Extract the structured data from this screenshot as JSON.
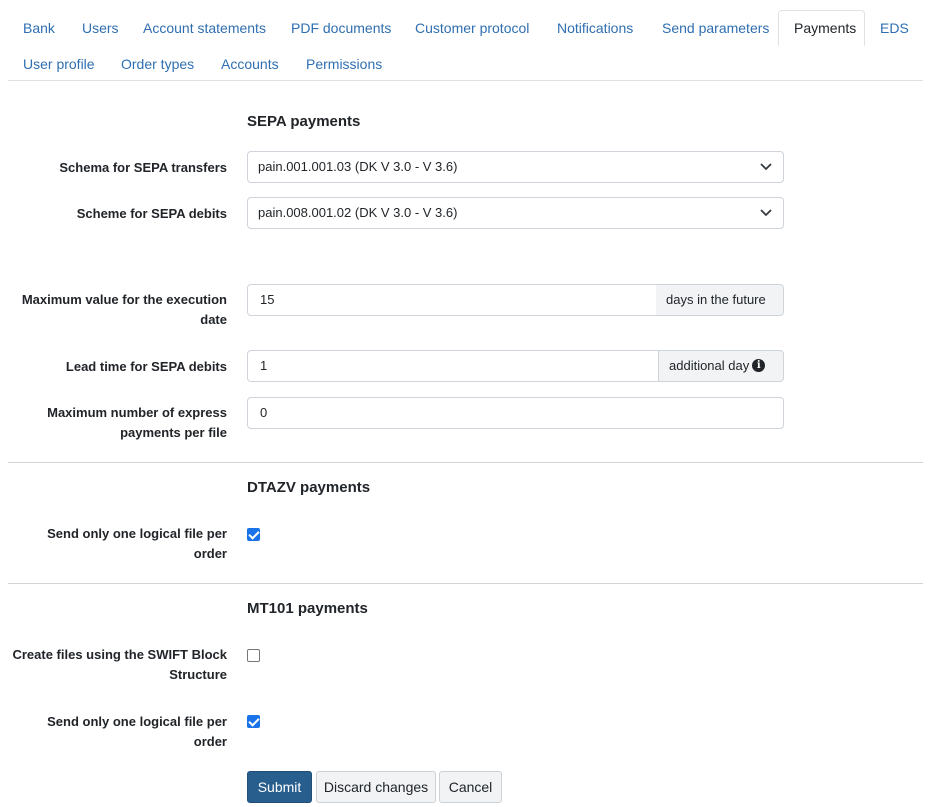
{
  "tabs": {
    "bank": "Bank",
    "users": "Users",
    "account_statements": "Account statements",
    "pdf_documents": "PDF documents",
    "customer_protocol": "Customer protocol",
    "notifications": "Notifications",
    "send_parameters": "Send parameters",
    "payments": "Payments",
    "eds": "EDS",
    "user_profile": "User profile",
    "order_types": "Order types",
    "accounts": "Accounts",
    "permissions": "Permissions"
  },
  "active_tab": "Payments",
  "sepa": {
    "title": "SEPA payments",
    "transfer_schema_label": "Schema for SEPA transfers",
    "transfer_schema_value": "pain.001.001.03 (DK V 3.0 - V 3.6)",
    "debit_scheme_label": "Scheme for SEPA debits",
    "debit_scheme_value": "pain.008.001.02 (DK V 3.0 - V 3.6)",
    "max_exec_label_line1": "Maximum value for the execution",
    "max_exec_label_line2": "date",
    "max_exec_value": "15",
    "max_exec_addon": "days in the future",
    "lead_time_label": "Lead time for SEPA debits",
    "lead_time_value": "1",
    "lead_time_addon": "additional day",
    "express_label_line1": "Maximum number of express",
    "express_label_line2": "payments per file",
    "express_value": "0"
  },
  "dtazv": {
    "title": "DTAZV payments",
    "one_file_label_line1": "Send only one logical file per",
    "one_file_label_line2": "order",
    "one_file_checked": true
  },
  "mt101": {
    "title": "MT101 payments",
    "swift_label_line1": "Create files using the SWIFT Block",
    "swift_label_line2": "Structure",
    "swift_checked": false,
    "one_file_label_line1": "Send only one logical file per",
    "one_file_label_line2": "order",
    "one_file_checked": true
  },
  "buttons": {
    "submit": "Submit",
    "discard": "Discard changes",
    "cancel": "Cancel"
  },
  "colors": {
    "link": "#2f6fb1",
    "primary": "#285e8e",
    "checkbox": "#1a73e8"
  }
}
